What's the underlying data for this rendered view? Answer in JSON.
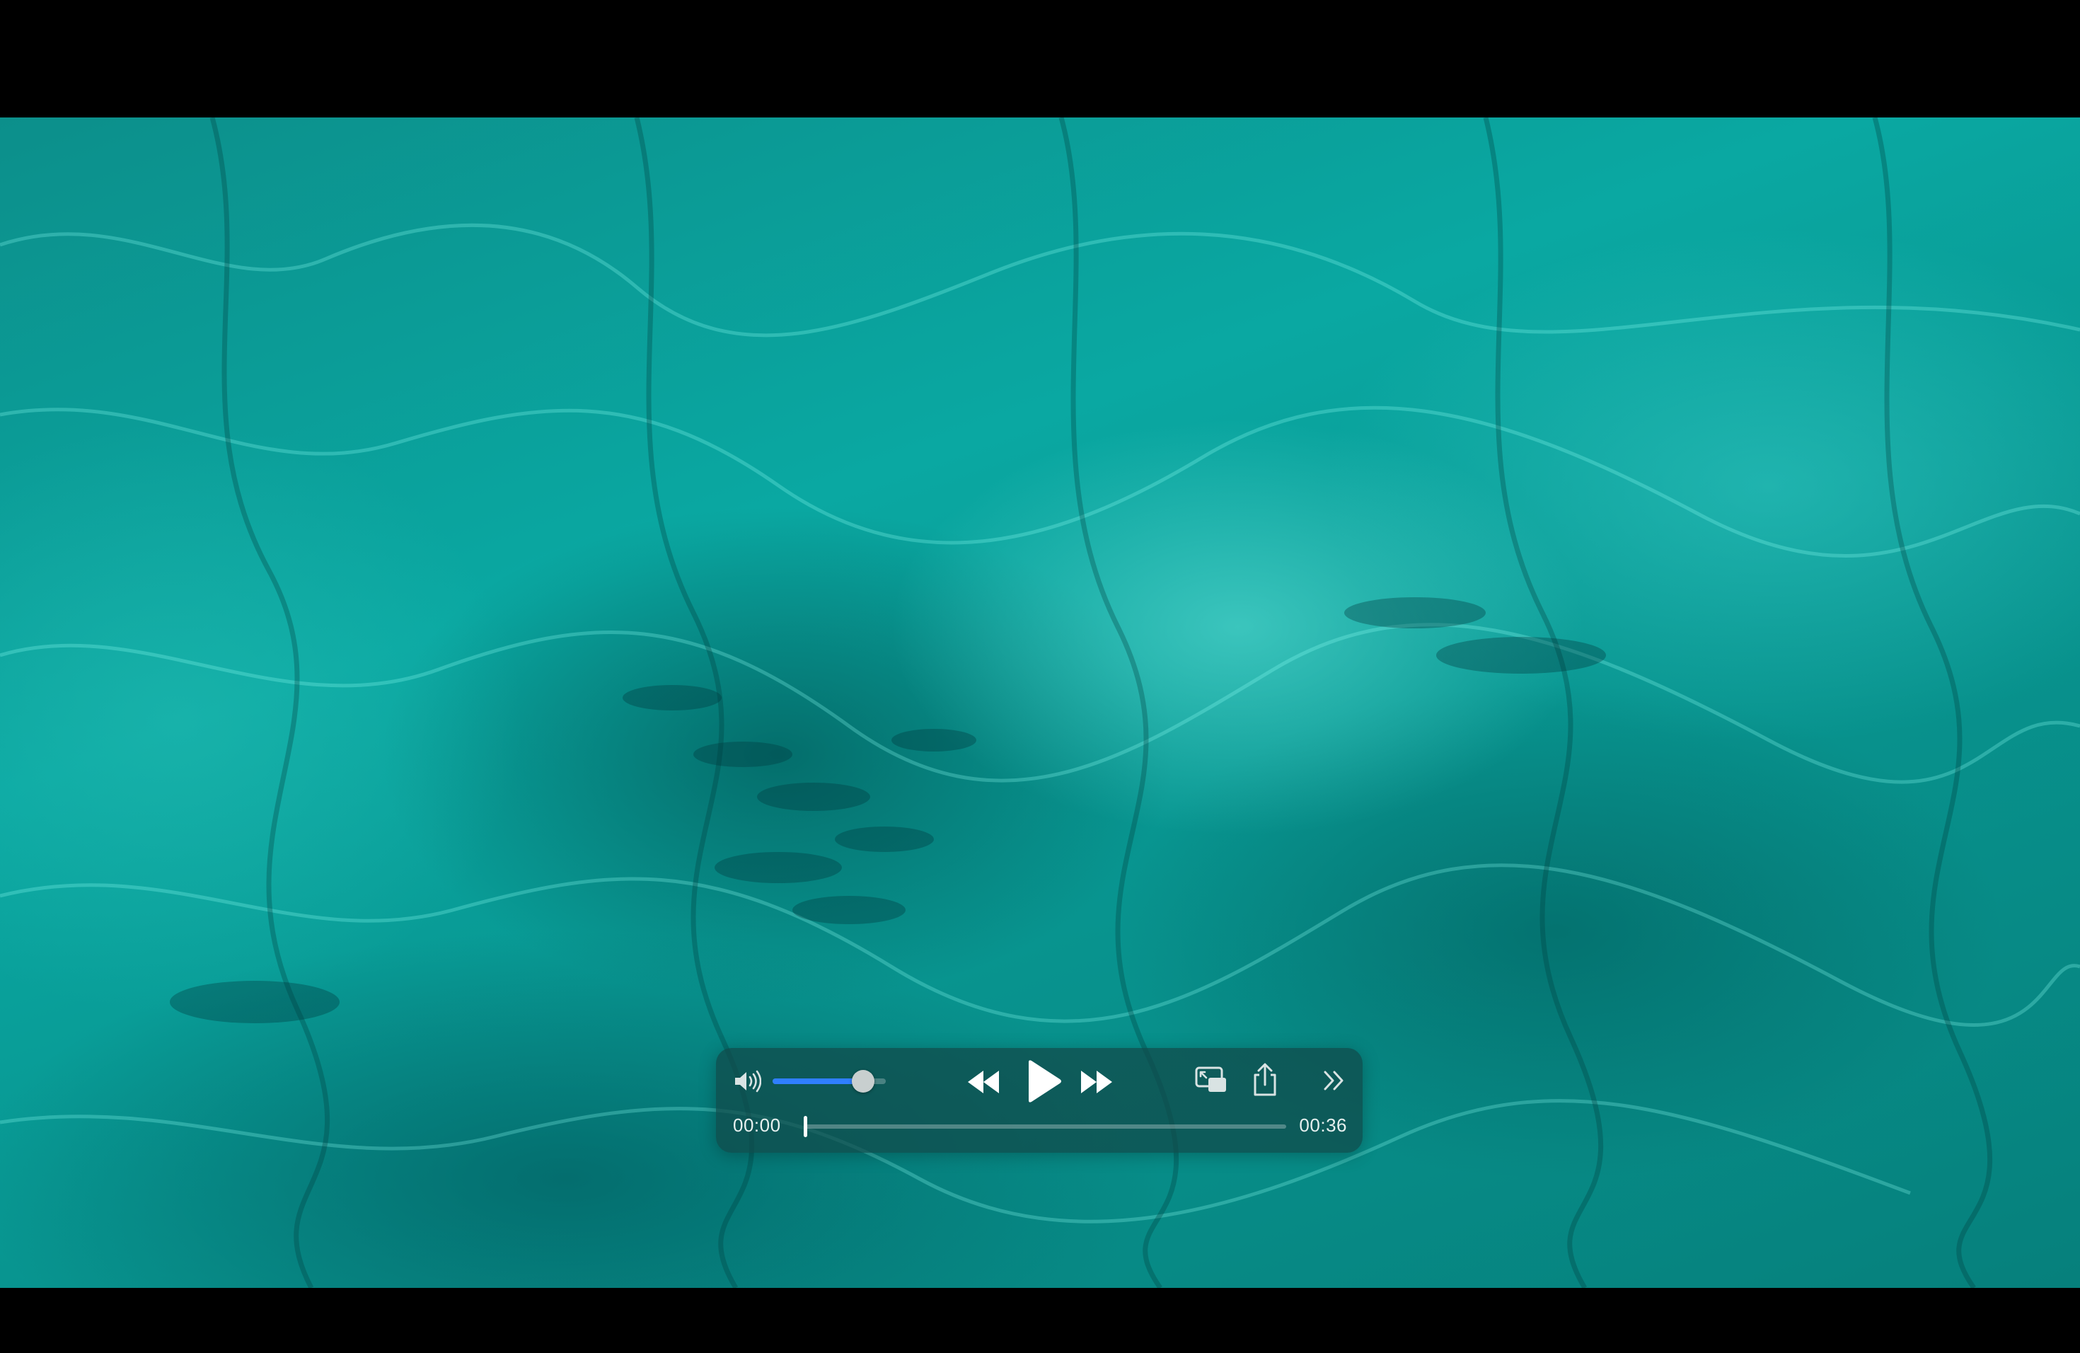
{
  "player": {
    "current_time": "00:00",
    "total_time": "00:36",
    "volume_level": 0.8,
    "progress": 0.0,
    "paused": true
  },
  "icons": {
    "volume": "speaker-wave-icon",
    "rewind": "rewind-icon",
    "play": "play-icon",
    "fast_forward": "fast-forward-icon",
    "pip": "picture-in-picture-icon",
    "share": "share-icon",
    "more": "chevron-double-right-icon"
  },
  "colors": {
    "accent": "#2f7fff",
    "hud_background": "#104848",
    "video_tint": "#0aa8a2",
    "letterbox": "#000000"
  }
}
